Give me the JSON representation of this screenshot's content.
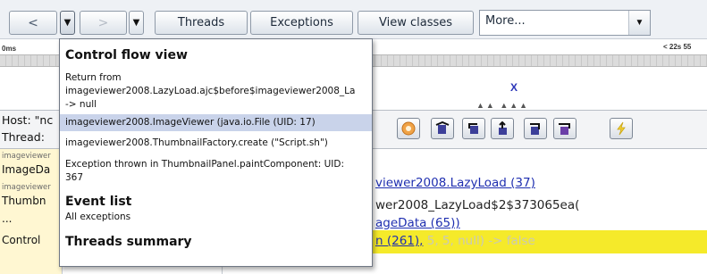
{
  "toolbar": {
    "back_label": "<",
    "back_drop": "▼",
    "forward_label": ">",
    "forward_drop": "▼",
    "threads_label": "Threads",
    "exceptions_label": "Exceptions",
    "view_classes_label": "View classes",
    "more_value": "More...",
    "more_drop": "▼"
  },
  "timeline": {
    "left_tick": "0ms",
    "right_tick": "< 22s 55",
    "marker": "X",
    "dots": "▲▲ ▲▲▲"
  },
  "info": {
    "host_label": "Host: \"nc",
    "thread_label": "Thread:"
  },
  "step_buttons": [
    {
      "icon": "stop-icon"
    },
    {
      "icon": "step-back-into-icon"
    },
    {
      "icon": "step-back-over-icon"
    },
    {
      "icon": "step-out-icon"
    },
    {
      "icon": "step-over-icon"
    },
    {
      "icon": "step-into-icon"
    },
    {
      "icon": "lightning-icon"
    }
  ],
  "stack": {
    "rows": [
      {
        "text": "imageviewer",
        "small": true
      },
      {
        "text": "ImageDa",
        "small": false
      },
      {
        "text": "imageviewer",
        "small": true
      },
      {
        "text": "Thumbn",
        "small": false
      },
      {
        "text": "...",
        "small": false
      },
      {
        "text": "Control",
        "small": false
      }
    ]
  },
  "code": {
    "line1_link": "viewer2008.LazyLoad (37)",
    "line2_text": "wer2008_LazyLoad$2$373065ea(",
    "line3_link": "ageData (65))",
    "line4_link": "n (261),",
    "line4_args": " 5, 5, null) ",
    "line4_result": "-> false"
  },
  "popup": {
    "control_flow_title": "Control flow view",
    "return_from": "Return from",
    "return_method": "imageviewer2008.LazyLoad.ajc$before$imageviewer2008_La",
    "return_null": " -> null",
    "selected_item": "imageviewer2008.ImageViewer (java.io.File (UID: 17)",
    "thumbnail_create": "imageviewer2008.ThumbnailFactory.create (\"Script.sh\")",
    "exception_line1": "Exception thrown in ThumbnailPanel.paintComponent: UID:",
    "exception_line2": "367",
    "event_list_title": "Event list",
    "all_exceptions": "All exceptions",
    "threads_summary_title": "Threads summary"
  },
  "colors": {
    "highlight": "#f5ea2a",
    "link": "#1f2fb0",
    "selection": "#c9d3ea",
    "stack_bg": "#fff7d2"
  }
}
